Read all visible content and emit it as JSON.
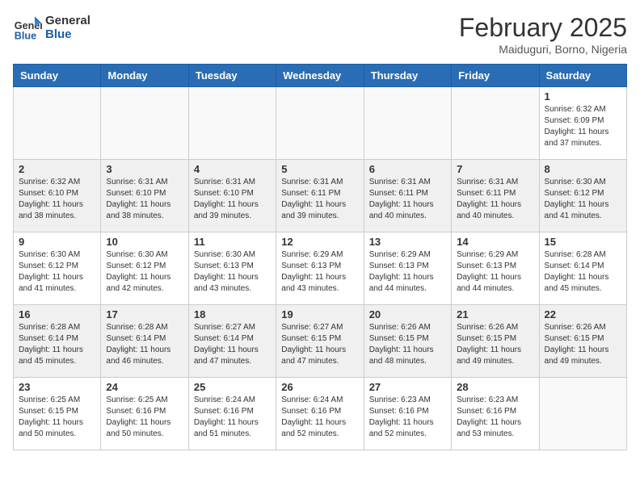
{
  "header": {
    "logo_text_general": "General",
    "logo_text_blue": "Blue",
    "month_title": "February 2025",
    "location": "Maiduguri, Borno, Nigeria"
  },
  "days_of_week": [
    "Sunday",
    "Monday",
    "Tuesday",
    "Wednesday",
    "Thursday",
    "Friday",
    "Saturday"
  ],
  "weeks": [
    {
      "days": [
        {
          "number": "",
          "info": ""
        },
        {
          "number": "",
          "info": ""
        },
        {
          "number": "",
          "info": ""
        },
        {
          "number": "",
          "info": ""
        },
        {
          "number": "",
          "info": ""
        },
        {
          "number": "",
          "info": ""
        },
        {
          "number": "1",
          "info": "Sunrise: 6:32 AM\nSunset: 6:09 PM\nDaylight: 11 hours\nand 37 minutes."
        }
      ]
    },
    {
      "days": [
        {
          "number": "2",
          "info": "Sunrise: 6:32 AM\nSunset: 6:10 PM\nDaylight: 11 hours\nand 38 minutes."
        },
        {
          "number": "3",
          "info": "Sunrise: 6:31 AM\nSunset: 6:10 PM\nDaylight: 11 hours\nand 38 minutes."
        },
        {
          "number": "4",
          "info": "Sunrise: 6:31 AM\nSunset: 6:10 PM\nDaylight: 11 hours\nand 39 minutes."
        },
        {
          "number": "5",
          "info": "Sunrise: 6:31 AM\nSunset: 6:11 PM\nDaylight: 11 hours\nand 39 minutes."
        },
        {
          "number": "6",
          "info": "Sunrise: 6:31 AM\nSunset: 6:11 PM\nDaylight: 11 hours\nand 40 minutes."
        },
        {
          "number": "7",
          "info": "Sunrise: 6:31 AM\nSunset: 6:11 PM\nDaylight: 11 hours\nand 40 minutes."
        },
        {
          "number": "8",
          "info": "Sunrise: 6:30 AM\nSunset: 6:12 PM\nDaylight: 11 hours\nand 41 minutes."
        }
      ]
    },
    {
      "days": [
        {
          "number": "9",
          "info": "Sunrise: 6:30 AM\nSunset: 6:12 PM\nDaylight: 11 hours\nand 41 minutes."
        },
        {
          "number": "10",
          "info": "Sunrise: 6:30 AM\nSunset: 6:12 PM\nDaylight: 11 hours\nand 42 minutes."
        },
        {
          "number": "11",
          "info": "Sunrise: 6:30 AM\nSunset: 6:13 PM\nDaylight: 11 hours\nand 43 minutes."
        },
        {
          "number": "12",
          "info": "Sunrise: 6:29 AM\nSunset: 6:13 PM\nDaylight: 11 hours\nand 43 minutes."
        },
        {
          "number": "13",
          "info": "Sunrise: 6:29 AM\nSunset: 6:13 PM\nDaylight: 11 hours\nand 44 minutes."
        },
        {
          "number": "14",
          "info": "Sunrise: 6:29 AM\nSunset: 6:13 PM\nDaylight: 11 hours\nand 44 minutes."
        },
        {
          "number": "15",
          "info": "Sunrise: 6:28 AM\nSunset: 6:14 PM\nDaylight: 11 hours\nand 45 minutes."
        }
      ]
    },
    {
      "days": [
        {
          "number": "16",
          "info": "Sunrise: 6:28 AM\nSunset: 6:14 PM\nDaylight: 11 hours\nand 45 minutes."
        },
        {
          "number": "17",
          "info": "Sunrise: 6:28 AM\nSunset: 6:14 PM\nDaylight: 11 hours\nand 46 minutes."
        },
        {
          "number": "18",
          "info": "Sunrise: 6:27 AM\nSunset: 6:14 PM\nDaylight: 11 hours\nand 47 minutes."
        },
        {
          "number": "19",
          "info": "Sunrise: 6:27 AM\nSunset: 6:15 PM\nDaylight: 11 hours\nand 47 minutes."
        },
        {
          "number": "20",
          "info": "Sunrise: 6:26 AM\nSunset: 6:15 PM\nDaylight: 11 hours\nand 48 minutes."
        },
        {
          "number": "21",
          "info": "Sunrise: 6:26 AM\nSunset: 6:15 PM\nDaylight: 11 hours\nand 49 minutes."
        },
        {
          "number": "22",
          "info": "Sunrise: 6:26 AM\nSunset: 6:15 PM\nDaylight: 11 hours\nand 49 minutes."
        }
      ]
    },
    {
      "days": [
        {
          "number": "23",
          "info": "Sunrise: 6:25 AM\nSunset: 6:15 PM\nDaylight: 11 hours\nand 50 minutes."
        },
        {
          "number": "24",
          "info": "Sunrise: 6:25 AM\nSunset: 6:16 PM\nDaylight: 11 hours\nand 50 minutes."
        },
        {
          "number": "25",
          "info": "Sunrise: 6:24 AM\nSunset: 6:16 PM\nDaylight: 11 hours\nand 51 minutes."
        },
        {
          "number": "26",
          "info": "Sunrise: 6:24 AM\nSunset: 6:16 PM\nDaylight: 11 hours\nand 52 minutes."
        },
        {
          "number": "27",
          "info": "Sunrise: 6:23 AM\nSunset: 6:16 PM\nDaylight: 11 hours\nand 52 minutes."
        },
        {
          "number": "28",
          "info": "Sunrise: 6:23 AM\nSunset: 6:16 PM\nDaylight: 11 hours\nand 53 minutes."
        },
        {
          "number": "",
          "info": ""
        }
      ]
    }
  ]
}
